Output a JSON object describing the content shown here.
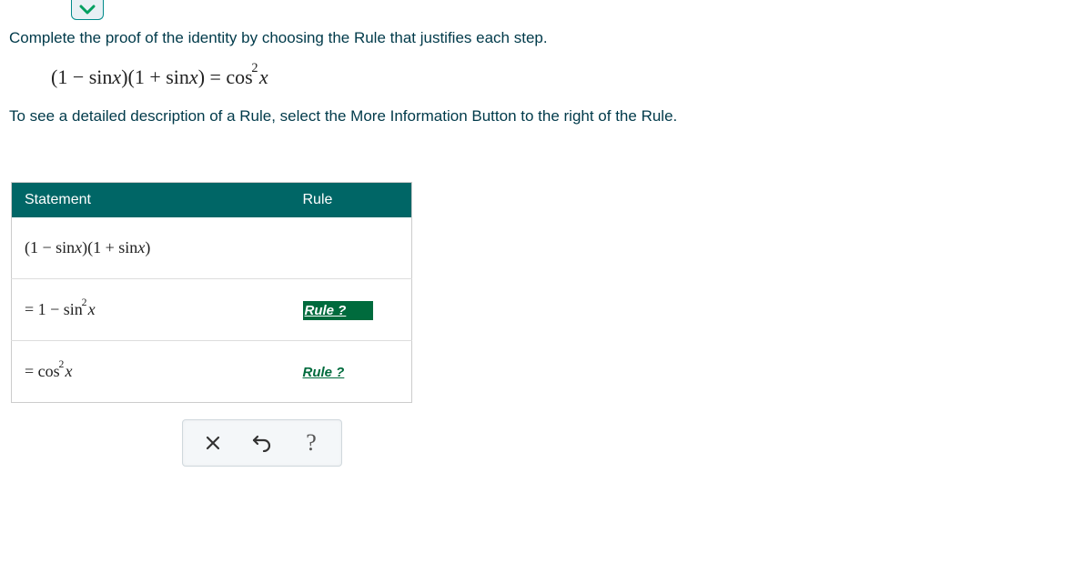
{
  "instruction1": "Complete the proof of the identity by choosing the Rule that justifies each step.",
  "identity_html": "(1 − sin<span style='font-style:italic'>x</span>)(1 + sin<span style='font-style:italic'>x</span>) = cos<sup>2</sup><span style='font-style:italic'>x</span>",
  "instruction2": "To see a detailed description of a Rule, select the More Information Button to the right of the Rule.",
  "table": {
    "headers": {
      "statement": "Statement",
      "rule": "Rule"
    },
    "rows": [
      {
        "statement_html": "(1 − sin<span style='font-style:italic'>x</span>)(1 + sin<span style='font-style:italic'>x</span>)",
        "rule": ""
      },
      {
        "statement_html": "= 1 − sin<span class='sup'>2</span><span style='font-style:italic'>x</span>",
        "rule": "Rule ?",
        "selected": true
      },
      {
        "statement_html": "= cos<span class='sup'>2</span><span style='font-style:italic'>x</span>",
        "rule": "Rule ?",
        "selected": false
      }
    ]
  },
  "toolbar": {
    "clear": "clear",
    "undo": "undo",
    "help": "?"
  }
}
